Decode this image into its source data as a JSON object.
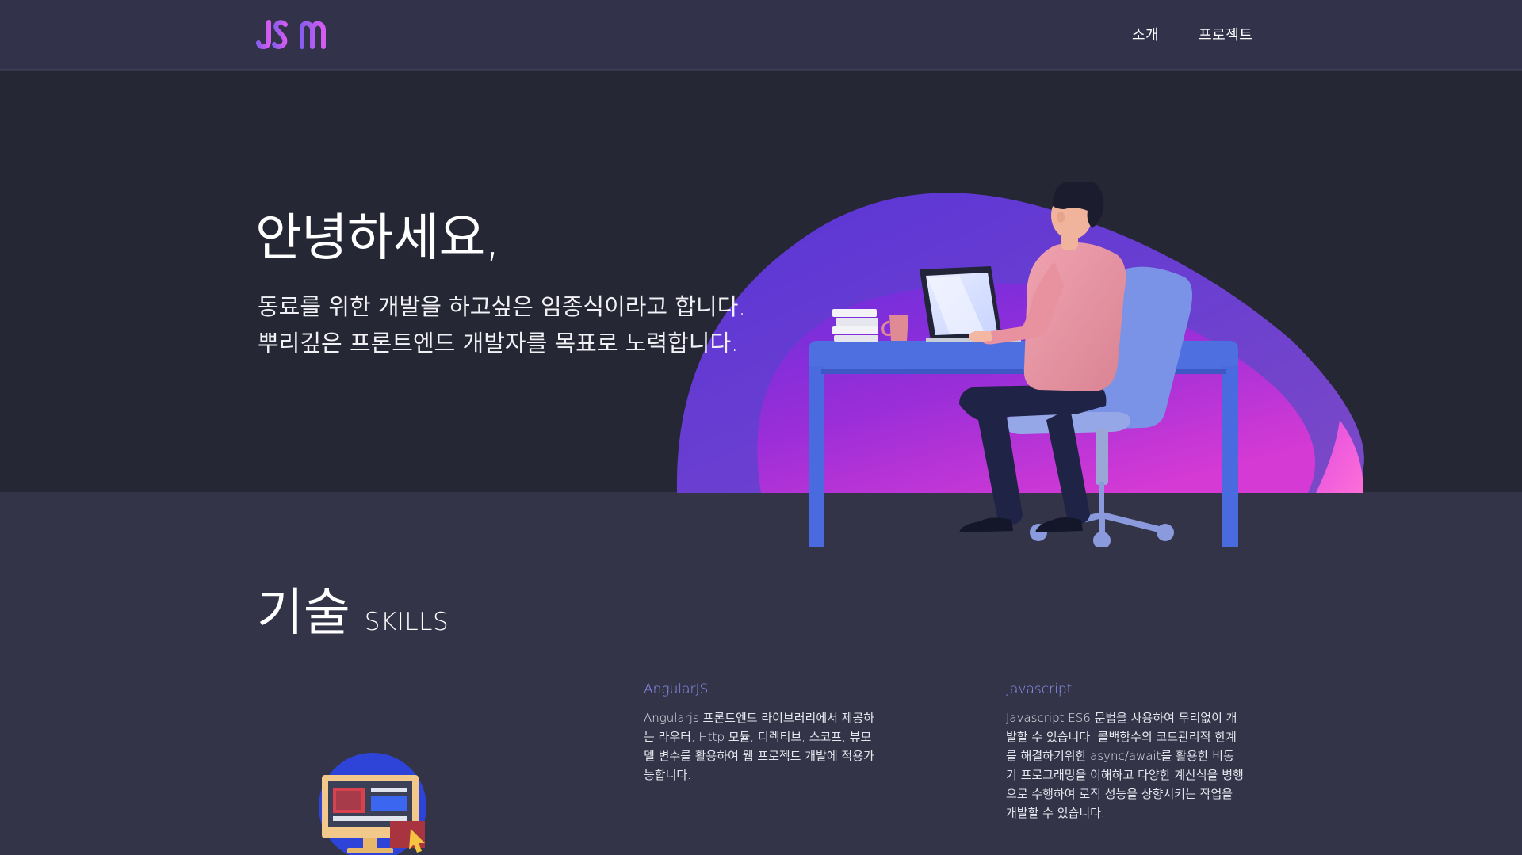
{
  "header": {
    "logo_text": "JSIM",
    "nav": [
      {
        "label": "소개"
      },
      {
        "label": "프로젝트"
      }
    ]
  },
  "hero": {
    "title": "안녕하세요,",
    "desc_line1": "동료를 위한 개발을 하고싶은 임종식이라고 합니다.",
    "desc_line2": "뿌리깊은 프론트엔드 개발자를 목표로 노력합니다."
  },
  "skills": {
    "title_ko": "기술",
    "title_en": "SKILLS",
    "items": [
      {
        "name": "AngularJS",
        "desc": "Angularjs 프론트엔드 라이브러리에서 제공하는 라우터, Http 모듈, 디렉티브, 스코프, 뷰모델 변수를 활용하여 웹 프로젝트 개발에 적용가능합니다."
      },
      {
        "name": "Javascript",
        "desc": "Javascript ES6 문법을 사용하여 무리없이 개발할 수 있습니다. 콜백함수의 코드관리적 한계를 해결하기위한 async/await를 활용한 비동기 프로그래밍을 이해하고 다양한 계산식을 병행으로 수행하여 로직 성능을 상향시키는 작업을 개발할 수 있습니다."
      }
    ]
  },
  "colors": {
    "header_bg": "#32334a",
    "hero_bg": "#262734",
    "page_bg": "#333447",
    "accent": "#8f90f0",
    "logo_gradient_start": "#8a5cf0",
    "logo_gradient_end": "#d45cf0"
  }
}
